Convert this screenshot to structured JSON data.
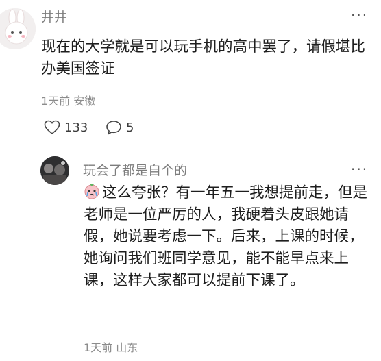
{
  "comment": {
    "username": "井井",
    "text": "现在的大学就是可以玩手机的高中罢了，请假堪比办美国签证",
    "time": "1天前",
    "location": "安徽",
    "like_count": "133",
    "reply_count": "5"
  },
  "reply": {
    "username": "玩会了都是自个的",
    "text": "这么夸张？有一年五一我想提前走，但是老师是一位严厉的人，我硬着头皮跟她请假，她说要考虑一下。后来，上课的时候，她询问我们班同学意见，能不能早点来上课，这样大家都可以提前下课了。",
    "time": "1天前",
    "location": "山东"
  },
  "more_glyph": "···",
  "icons": {
    "like": "heart-outline-icon",
    "reply": "speech-bubble-icon",
    "emoji": "crying-face-emoji-icon"
  }
}
